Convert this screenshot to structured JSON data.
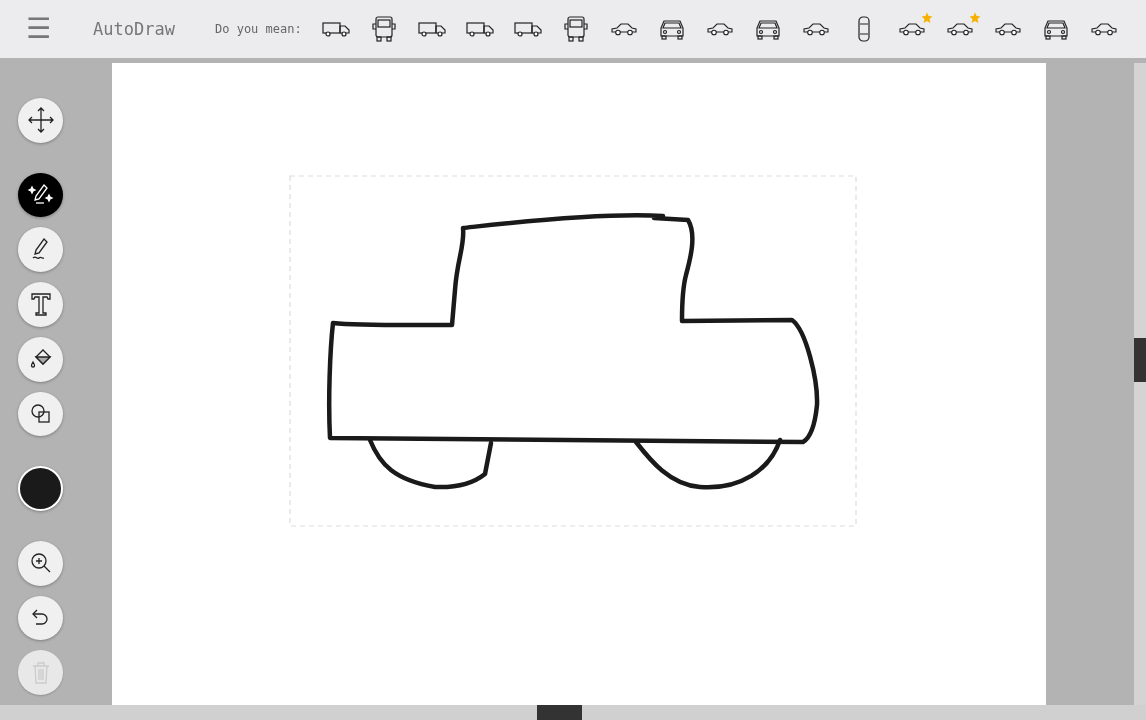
{
  "app_title": "AutoDraw",
  "menu_icon": "☰",
  "suggestion_prompt": "Do you mean:",
  "suggestions": [
    {
      "kind": "truck",
      "starred": false
    },
    {
      "kind": "truck-front",
      "starred": false
    },
    {
      "kind": "truck",
      "starred": false
    },
    {
      "kind": "truck",
      "starred": false
    },
    {
      "kind": "truck",
      "starred": false
    },
    {
      "kind": "truck-front",
      "starred": false
    },
    {
      "kind": "car-side",
      "starred": false
    },
    {
      "kind": "car-front",
      "starred": false
    },
    {
      "kind": "car-side",
      "starred": false
    },
    {
      "kind": "car-front",
      "starred": false
    },
    {
      "kind": "car-side",
      "starred": false
    },
    {
      "kind": "car-top",
      "starred": false
    },
    {
      "kind": "car-side",
      "starred": true
    },
    {
      "kind": "car-side",
      "starred": true
    },
    {
      "kind": "car-side",
      "starred": false
    },
    {
      "kind": "car-front",
      "starred": false
    },
    {
      "kind": "car-side",
      "starred": false
    }
  ],
  "tools": [
    {
      "kind": "move",
      "selected": false,
      "disabled": false
    },
    {
      "kind": "autodraw",
      "selected": true,
      "disabled": false
    },
    {
      "kind": "draw",
      "selected": false,
      "disabled": false
    },
    {
      "kind": "type",
      "selected": false,
      "disabled": false
    },
    {
      "kind": "fill",
      "selected": false,
      "disabled": false
    },
    {
      "kind": "shape",
      "selected": false,
      "disabled": false
    },
    {
      "kind": "color",
      "color": "#1a1a1a"
    },
    {
      "kind": "zoom",
      "selected": false,
      "disabled": false
    },
    {
      "kind": "undo",
      "selected": false,
      "disabled": false
    },
    {
      "kind": "delete",
      "selected": false,
      "disabled": true
    }
  ]
}
